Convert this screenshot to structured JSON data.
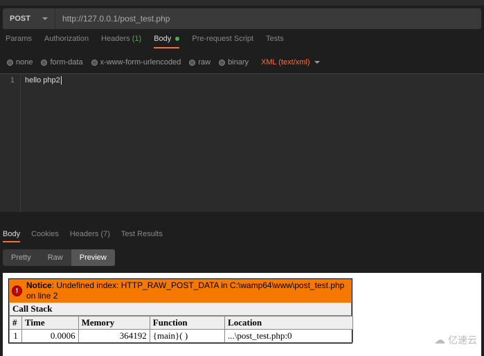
{
  "request": {
    "method": "POST",
    "url": "http://127.0.0.1/post_test.php"
  },
  "tabs": {
    "params": "Params",
    "auth": "Authorization",
    "headers": "Headers",
    "headers_count": "(1)",
    "body": "Body",
    "prerequest": "Pre-request Script",
    "tests": "Tests"
  },
  "body_types": {
    "none": "none",
    "formdata": "form-data",
    "urlencoded": "x-www-form-urlencoded",
    "raw": "raw",
    "binary": "binary",
    "content_type": "XML (text/xml)"
  },
  "editor": {
    "line1": "1",
    "content": "hello php2"
  },
  "response_tabs": {
    "body": "Body",
    "cookies": "Cookies",
    "headers": "Headers",
    "headers_count": "(7)",
    "test_results": "Test Results"
  },
  "view_tabs": {
    "pretty": "Pretty",
    "raw": "Raw",
    "preview": "Preview"
  },
  "error": {
    "notice_bold": "Notice",
    "notice_text": ": Undefined index: HTTP_RAW_POST_DATA in C:\\wamp64\\www\\post_test.php on line 2",
    "callstack": "Call Stack",
    "headers": {
      "num": "#",
      "time": "Time",
      "memory": "Memory",
      "function": "Function",
      "location": "Location"
    },
    "row": {
      "num": "1",
      "time": "0.0006",
      "memory": "364192",
      "function": "{main}( )",
      "location": "...\\post_test.php:0"
    }
  },
  "watermark": "亿速云"
}
